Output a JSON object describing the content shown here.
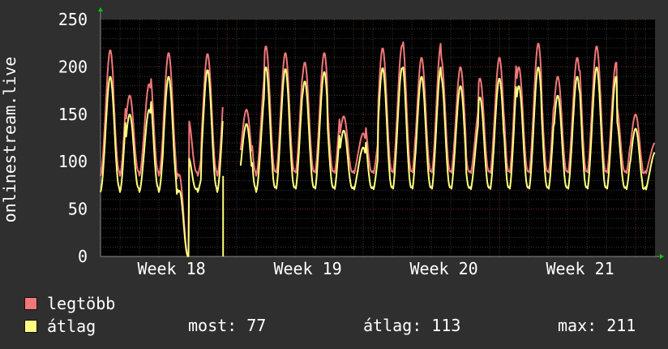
{
  "chart_data": {
    "type": "line",
    "ylabel": "onlinestream.live",
    "ylim": [
      0,
      250
    ],
    "yticks": [
      0,
      50,
      100,
      150,
      200,
      250
    ],
    "xticks": [
      "Week 18",
      "Week 19",
      "Week 20",
      "Week 21"
    ],
    "grid": true,
    "days": 28.5,
    "gap": {
      "start_day": 6.3,
      "end_day": 7.2
    },
    "series": [
      {
        "name": "legtöbb",
        "color": "#f07878",
        "daily_peaks": [
          218,
          205,
          170,
          182,
          200,
          215,
          0,
          145,
          214,
          208,
          180,
          155,
          198,
          222,
          215,
          210,
          205,
          215,
          185,
          148,
          130,
          150,
          220,
          223,
          232,
          210,
          225,
          210,
          200,
          160,
          188,
          210,
          228,
          200,
          225,
          205,
          190,
          210,
          225,
          222,
          205,
          160,
          150,
          120
        ],
        "night_base": 85
      },
      {
        "name": "átlag",
        "color": "#ffff80",
        "daily_peaks": [
          190,
          192,
          150,
          155,
          175,
          190,
          0,
          105,
          197,
          195,
          160,
          140,
          178,
          200,
          198,
          190,
          185,
          195,
          168,
          133,
          115,
          135,
          199,
          199,
          205,
          190,
          200,
          190,
          180,
          145,
          168,
          188,
          205,
          180,
          200,
          185,
          170,
          190,
          200,
          200,
          190,
          145,
          135,
          110
        ],
        "night_base": 68
      }
    ],
    "legend": {
      "placement": "bottom-left"
    }
  },
  "legend": {
    "items": [
      {
        "label": "legtöbb",
        "color": "#f07878"
      },
      {
        "label": "átlag",
        "color": "#ffff80"
      }
    ],
    "stats": {
      "now": "most: 77",
      "avg": "átlag: 113",
      "max": "max: 211"
    }
  }
}
